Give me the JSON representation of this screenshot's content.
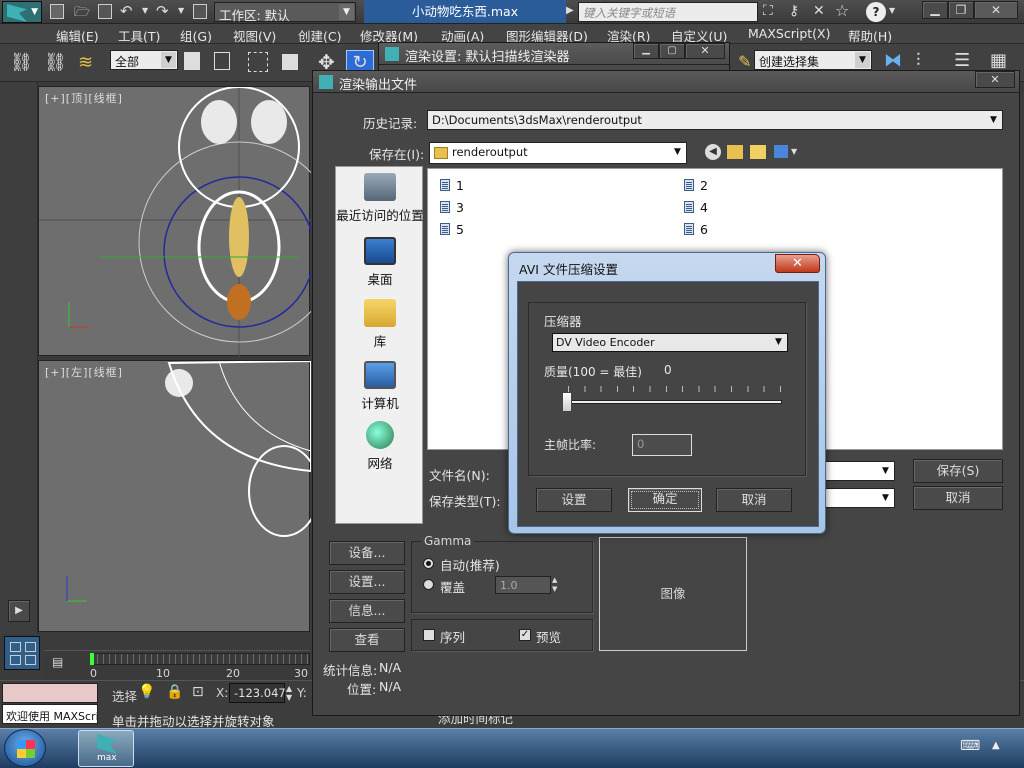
{
  "app": {
    "document_title": "小动物吃东西.max",
    "workspace_label": "工作区: 默认",
    "search_placeholder": "键入关键字或短语"
  },
  "menu": [
    "编辑(E)",
    "工具(T)",
    "组(G)",
    "视图(V)",
    "创建(C)",
    "修改器(M)",
    "动画(A)",
    "图形编辑器(D)",
    "渲染(R)",
    "自定义(U)",
    "MAXScript(X)",
    "帮助(H)"
  ],
  "toolbar": {
    "filter_value": "全部",
    "named_selection": "创建选择集"
  },
  "viewports": {
    "top_label": "[+][顶][线框]",
    "left_label": "[+][左][线框]"
  },
  "render_setup": {
    "title": "渲染设置: 默认扫描线渲染器"
  },
  "render_output": {
    "title": "渲染输出文件",
    "history_label": "历史记录:",
    "history_value": "D:\\Documents\\3dsMax\\renderoutput",
    "save_in_label": "保存在(I):",
    "save_in_value": "renderoutput",
    "places": [
      "最近访问的位置",
      "桌面",
      "库",
      "计算机",
      "网络"
    ],
    "files": [
      "1",
      "2",
      "3",
      "4",
      "5",
      "6"
    ],
    "filename_label": "文件名(N):",
    "filetype_label": "保存类型(T):",
    "save_btn": "保存(S)",
    "cancel_btn": "取消",
    "devices_btn": "设备...",
    "setup_btn": "设置...",
    "info_btn": "信息...",
    "view_btn": "查看",
    "gamma": {
      "title": "Gamma",
      "auto": "自动(推荐)",
      "override": "覆盖",
      "override_value": "1.0",
      "selected": "auto"
    },
    "sequence_label": "序列",
    "sequence_checked": false,
    "preview_label": "预览",
    "preview_checked": true,
    "image_label": "图像",
    "stats_label": "统计信息:",
    "stats_value": "N/A",
    "location_label": "位置:",
    "location_value": "N/A"
  },
  "avi_dialog": {
    "title": "AVI 文件压缩设置",
    "group_label": "压缩器",
    "compressor_value": "DV Video Encoder",
    "quality_label": "质量(100 = 最佳)",
    "quality_value": "0",
    "quality_level": 0,
    "keyframe_label": "主帧比率:",
    "keyframe_value": "0",
    "setup_btn": "设置",
    "ok_btn": "确定",
    "cancel_btn": "取消"
  },
  "timeline": {
    "ticks": [
      "0",
      "10",
      "20",
      "30"
    ]
  },
  "status": {
    "maxscript_text": "欢迎使用 MAXScri",
    "select_label": "选择",
    "x_label": "X:",
    "x_value": "-123.047",
    "y_label": "Y:",
    "prompt": "单击并拖动以选择并旋转对象",
    "add_time_tag": "添加时间标记"
  },
  "taskbar": {
    "app_label": "max"
  },
  "colors": {
    "accent_blue": "#1f5fbf",
    "viewport_bg": "#6e6e6e",
    "ui_dark": "#444444"
  }
}
